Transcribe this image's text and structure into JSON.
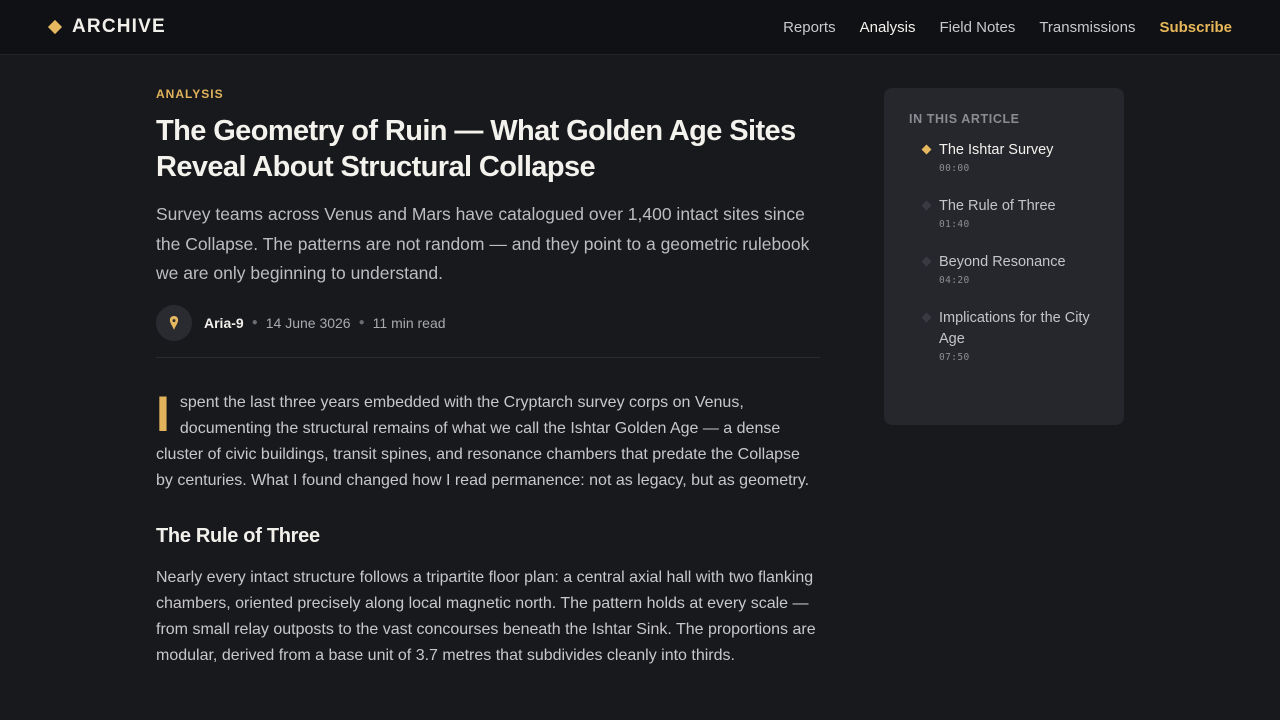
{
  "brand": {
    "name": "ARCHIVE",
    "icon": "diamond-icon",
    "accent": "#e6b85f"
  },
  "nav": {
    "items": [
      "Reports",
      "Analysis",
      "Field Notes",
      "Transmissions"
    ],
    "active": "Analysis",
    "subscribe": "Subscribe"
  },
  "article": {
    "kicker": "ANALYSIS",
    "title": "The Geometry of Ruin — What Golden Age Sites Reveal About Structural Collapse",
    "dek": "Survey teams across Venus and Mars have catalogued over 1,400 intact sites since the Collapse. The patterns are not random — and they point to a geometric rulebook we are only beginning to understand.",
    "author": "Aria-9",
    "date": "14 June 3026",
    "read_time": "11 min read",
    "avatar_icon": "pin-icon",
    "dropcap": "I",
    "lede_rest": "spent the last three years embedded with the Cryptarch survey corps on Venus, documenting the structural remains of what we call the Ishtar Golden Age — a dense cluster of civic buildings, transit spines, and resonance chambers that predate the Collapse by centuries. What I found changed how I read permanence: not as legacy, but as geometry.",
    "section_heading": "The Rule of Three",
    "paragraph_2": "Nearly every intact structure follows a tripartite floor plan: a central axial hall with two flanking chambers, oriented precisely along local magnetic north. The pattern holds at every scale — from small relay outposts to the vast concourses beneath the Ishtar Sink. The proportions are modular, derived from a base unit of 3.7 metres that subdivides cleanly into thirds."
  },
  "toc": {
    "heading": "IN THIS ARTICLE",
    "items": [
      {
        "label": "The Ishtar Survey",
        "time": "00:00",
        "active": true
      },
      {
        "label": "The Rule of Three",
        "time": "01:40",
        "active": false
      },
      {
        "label": "Beyond Resonance",
        "time": "04:20",
        "active": false
      },
      {
        "label": "Implications for the City Age",
        "time": "07:50",
        "active": false
      }
    ]
  }
}
